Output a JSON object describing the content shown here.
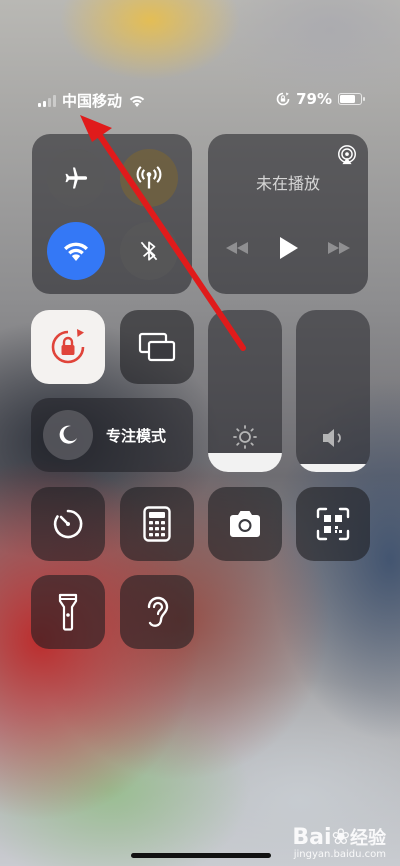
{
  "status": {
    "carrier": "中国移动",
    "battery": "79%",
    "battery_level": 0.79
  },
  "media": {
    "title": "未在播放"
  },
  "focus": {
    "label": "专注模式"
  },
  "sliders": {
    "brightness_level": 0.12,
    "volume_level": 0.05
  },
  "colors": {
    "wifi_active": "#3478f6",
    "annotation_arrow": "#e01b1b",
    "rotation_lock": "#e0443a"
  },
  "watermark": {
    "brand": "Bai",
    "brand_tail": "经验",
    "url": "jingyan.baidu.com"
  }
}
